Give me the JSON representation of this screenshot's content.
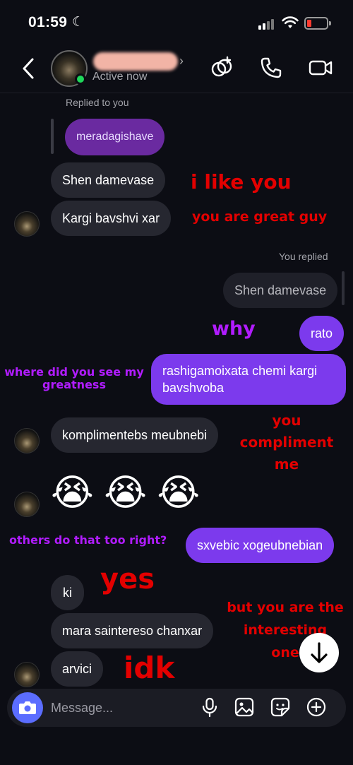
{
  "status_bar": {
    "time": "01:59",
    "moon": "☾"
  },
  "header": {
    "active_status": "Active now",
    "icons": [
      "back-chevron-icon",
      "effects-icon",
      "phone-icon",
      "video-icon"
    ]
  },
  "messages": {
    "replied_to_you": "Replied to you",
    "quoted": "meradagishave",
    "in_1": "Shen damevase",
    "in_2": "Kargi bavshvi xar",
    "you_replied": "You replied",
    "quoted_out": "Shen damevase",
    "out_1": "rato",
    "out_2_line1": "rashigamoixata chemi kargi",
    "out_2_line2": "bavshvoba",
    "in_3": "komplimentebs meubnebi",
    "emojis": "😭 😭 😭",
    "out_3": "sxvebic xogeubnebian",
    "in_4": "ki",
    "in_5": "mara saintereso chanxar",
    "in_6": "arvici"
  },
  "annotations": {
    "a1": "i like you",
    "a2": "you are great guy",
    "a3": "why",
    "a4_l1": "where did you see my",
    "a4_l2": "greatness",
    "a5_l1": "you",
    "a5_l2": "compliment",
    "a5_l3": "me",
    "a6": "others do that too right?",
    "a7": "yes",
    "a8_l1": "but you are the",
    "a8_l2": "interesting",
    "a8_l3": "one",
    "a9": "idk"
  },
  "composer": {
    "placeholder": "Message..."
  },
  "colors": {
    "accent": "#7c3aed",
    "annotation_red": "#e30000",
    "annotation_purple": "#b11cff",
    "camera": "#5b6dff",
    "online": "#1fd75a"
  }
}
